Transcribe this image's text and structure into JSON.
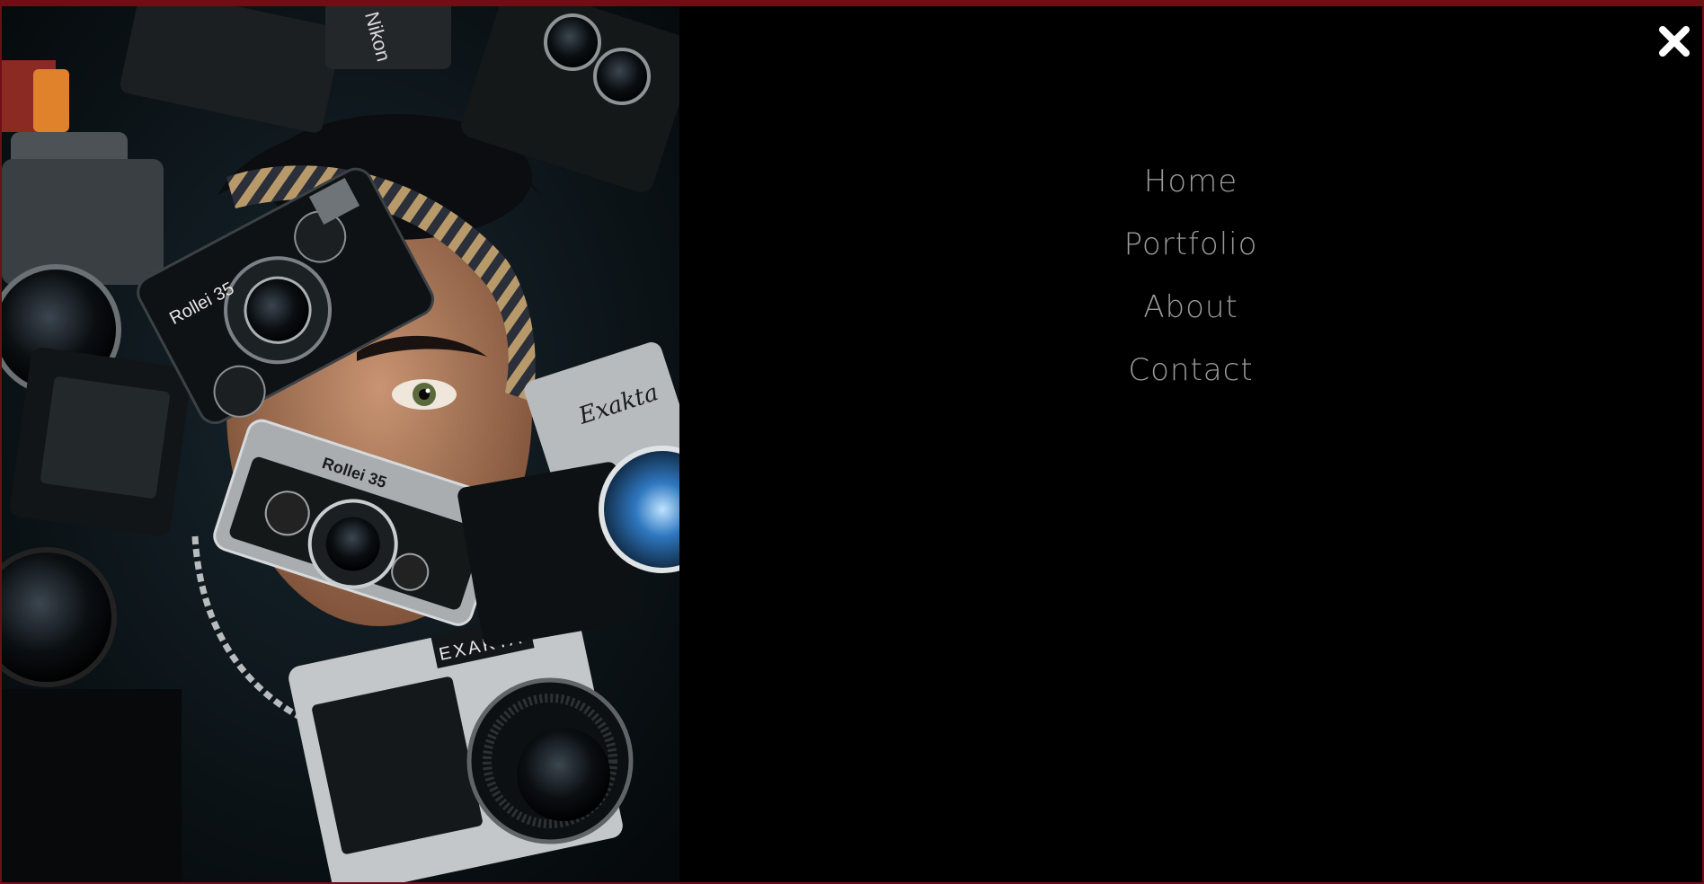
{
  "photo": {
    "alt": "Person's face surrounded by vintage cameras",
    "labels": {
      "rollei_top": "Rollei 35",
      "rollei_bottom": "Rollei 35",
      "exakta_front": "EXAKTA",
      "exakta_right": "Exakta",
      "nikon": "Nikon"
    }
  },
  "header": {
    "close_icon": "close-x-icon"
  },
  "nav": {
    "items": [
      {
        "label": "Home"
      },
      {
        "label": "Portfolio"
      },
      {
        "label": "About"
      },
      {
        "label": "Contact"
      }
    ]
  },
  "colors": {
    "background": "#000000",
    "nav_text": "#9a9a9a",
    "close_icon": "#ffffff",
    "frame_border": "#6e0f16"
  }
}
